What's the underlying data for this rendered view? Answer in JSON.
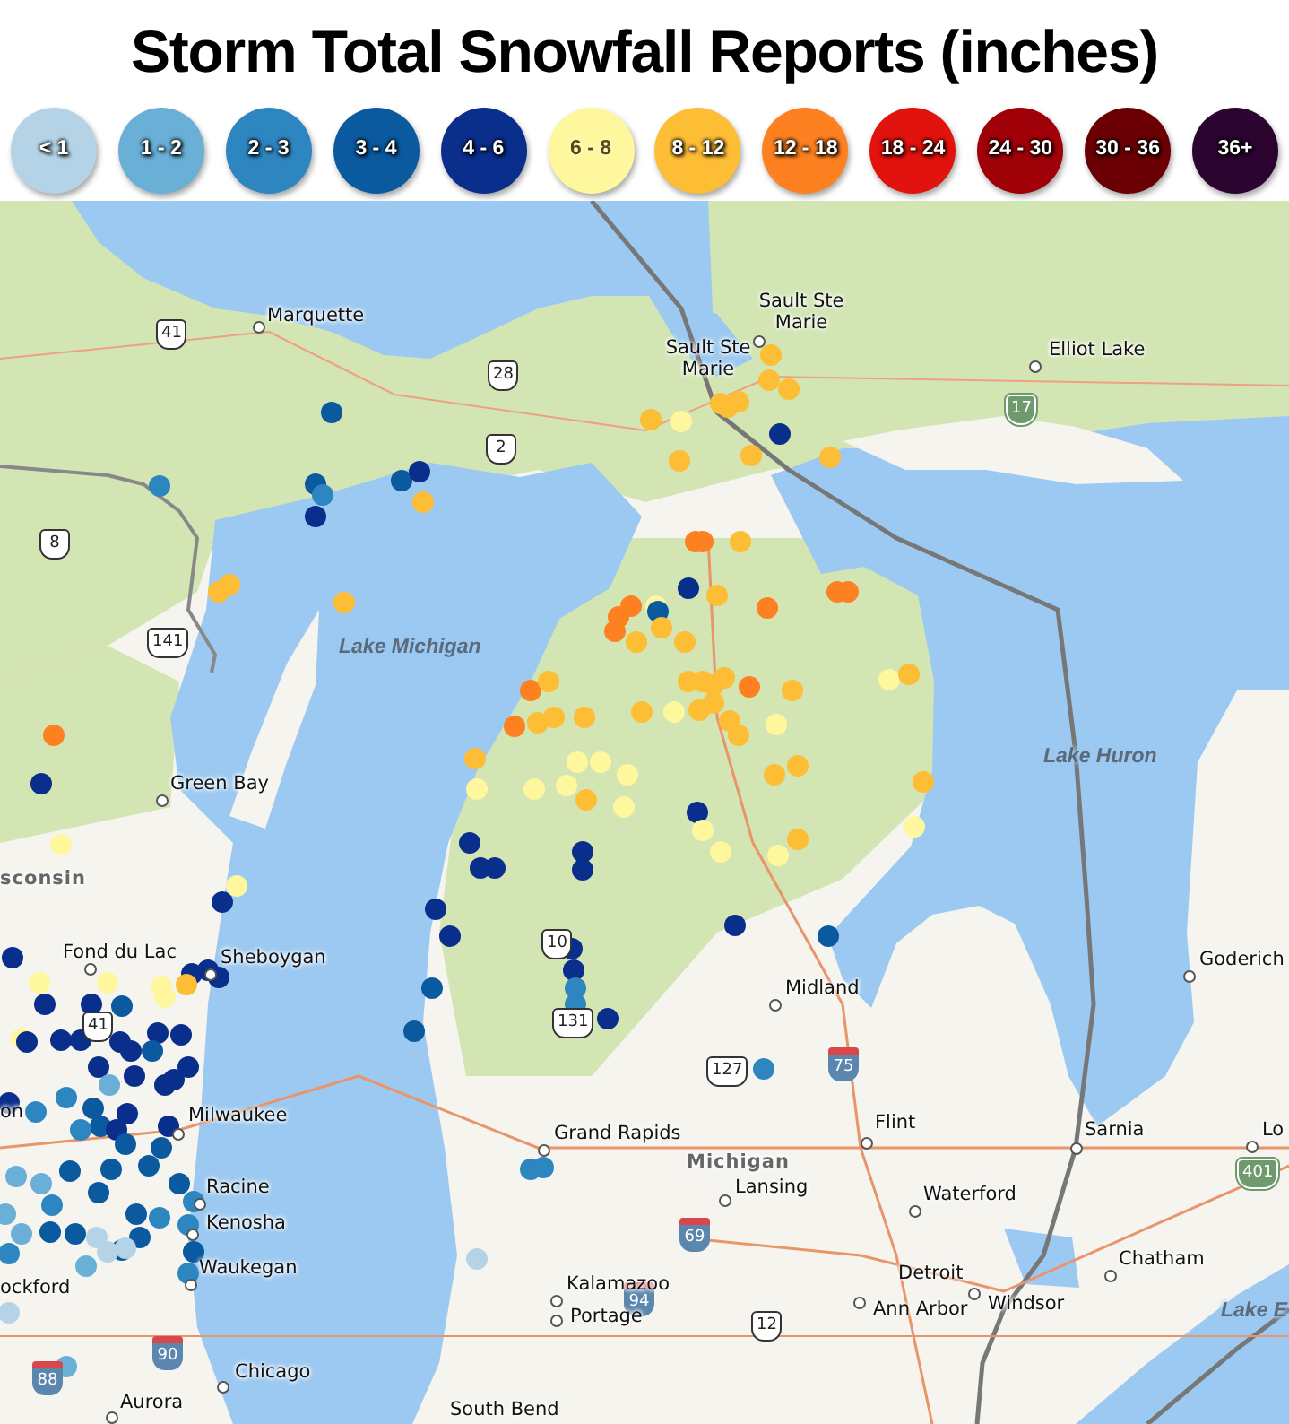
{
  "title": "Storm Total Snowfall Reports (inches)",
  "legend": [
    {
      "label": "< 1",
      "color": "#b4d3e6"
    },
    {
      "label": "1 - 2",
      "color": "#6aafd6"
    },
    {
      "label": "2 - 3",
      "color": "#2e86c0"
    },
    {
      "label": "3 - 4",
      "color": "#0b5aa0"
    },
    {
      "label": "4 - 6",
      "color": "#0a2e8c"
    },
    {
      "label": "6 - 8",
      "color": "#fff79e"
    },
    {
      "label": "8 - 12",
      "color": "#fdbd35"
    },
    {
      "label": "12 - 18",
      "color": "#fd8021"
    },
    {
      "label": "18 - 24",
      "color": "#e2120e"
    },
    {
      "label": "24 - 30",
      "color": "#a00008"
    },
    {
      "label": "30 - 36",
      "color": "#6b0004"
    },
    {
      "label": "36+",
      "color": "#2b0530"
    }
  ],
  "map": {
    "labels": [
      {
        "text": "Marquette",
        "kind": "city"
      },
      {
        "text": "Sault Ste Marie",
        "kind": "city"
      },
      {
        "text": "Sault Ste Marie",
        "kind": "city"
      },
      {
        "text": "Elliot Lake",
        "kind": "city"
      },
      {
        "text": "Lake Michigan",
        "kind": "lake"
      },
      {
        "text": "Lake Huron",
        "kind": "lake"
      },
      {
        "text": "Green Bay",
        "kind": "city"
      },
      {
        "text": "sconsin",
        "kind": "region"
      },
      {
        "text": "Fond du Lac",
        "kind": "city"
      },
      {
        "text": "Sheboygan",
        "kind": "city"
      },
      {
        "text": "on",
        "kind": "city"
      },
      {
        "text": "Milwaukee",
        "kind": "city"
      },
      {
        "text": "Racine",
        "kind": "city"
      },
      {
        "text": "Kenosha",
        "kind": "city"
      },
      {
        "text": "Waukegan",
        "kind": "city"
      },
      {
        "text": "ockford",
        "kind": "city"
      },
      {
        "text": "Chicago",
        "kind": "city"
      },
      {
        "text": "Aurora",
        "kind": "city"
      },
      {
        "text": "South Bend",
        "kind": "city"
      },
      {
        "text": "Grand Rapids",
        "kind": "city"
      },
      {
        "text": "Midland",
        "kind": "city"
      },
      {
        "text": "Goderich",
        "kind": "city"
      },
      {
        "text": "Flint",
        "kind": "city"
      },
      {
        "text": "Sarnia",
        "kind": "city"
      },
      {
        "text": "Lo",
        "kind": "city"
      },
      {
        "text": "Michigan",
        "kind": "region"
      },
      {
        "text": "Lansing",
        "kind": "city"
      },
      {
        "text": "Waterford",
        "kind": "city"
      },
      {
        "text": "Chatham",
        "kind": "city"
      },
      {
        "text": "Kalamazoo",
        "kind": "city"
      },
      {
        "text": "Detroit",
        "kind": "city"
      },
      {
        "text": "Portage",
        "kind": "city"
      },
      {
        "text": "Ann Arbor",
        "kind": "city"
      },
      {
        "text": "Windsor",
        "kind": "city"
      },
      {
        "text": "Lake E",
        "kind": "lake"
      }
    ],
    "shields": [
      {
        "number": "41",
        "kind": "us"
      },
      {
        "number": "28",
        "kind": "us"
      },
      {
        "number": "2",
        "kind": "us"
      },
      {
        "number": "17",
        "kind": "provincial"
      },
      {
        "number": "8",
        "kind": "us"
      },
      {
        "number": "141",
        "kind": "us"
      },
      {
        "number": "10",
        "kind": "us"
      },
      {
        "number": "41",
        "kind": "us"
      },
      {
        "number": "131",
        "kind": "us"
      },
      {
        "number": "127",
        "kind": "us"
      },
      {
        "number": "75",
        "kind": "interstate"
      },
      {
        "number": "401",
        "kind": "provincial"
      },
      {
        "number": "69",
        "kind": "interstate"
      },
      {
        "number": "94",
        "kind": "interstate"
      },
      {
        "number": "12",
        "kind": "us"
      },
      {
        "number": "90",
        "kind": "interstate"
      },
      {
        "number": "88",
        "kind": "interstate"
      }
    ]
  }
}
